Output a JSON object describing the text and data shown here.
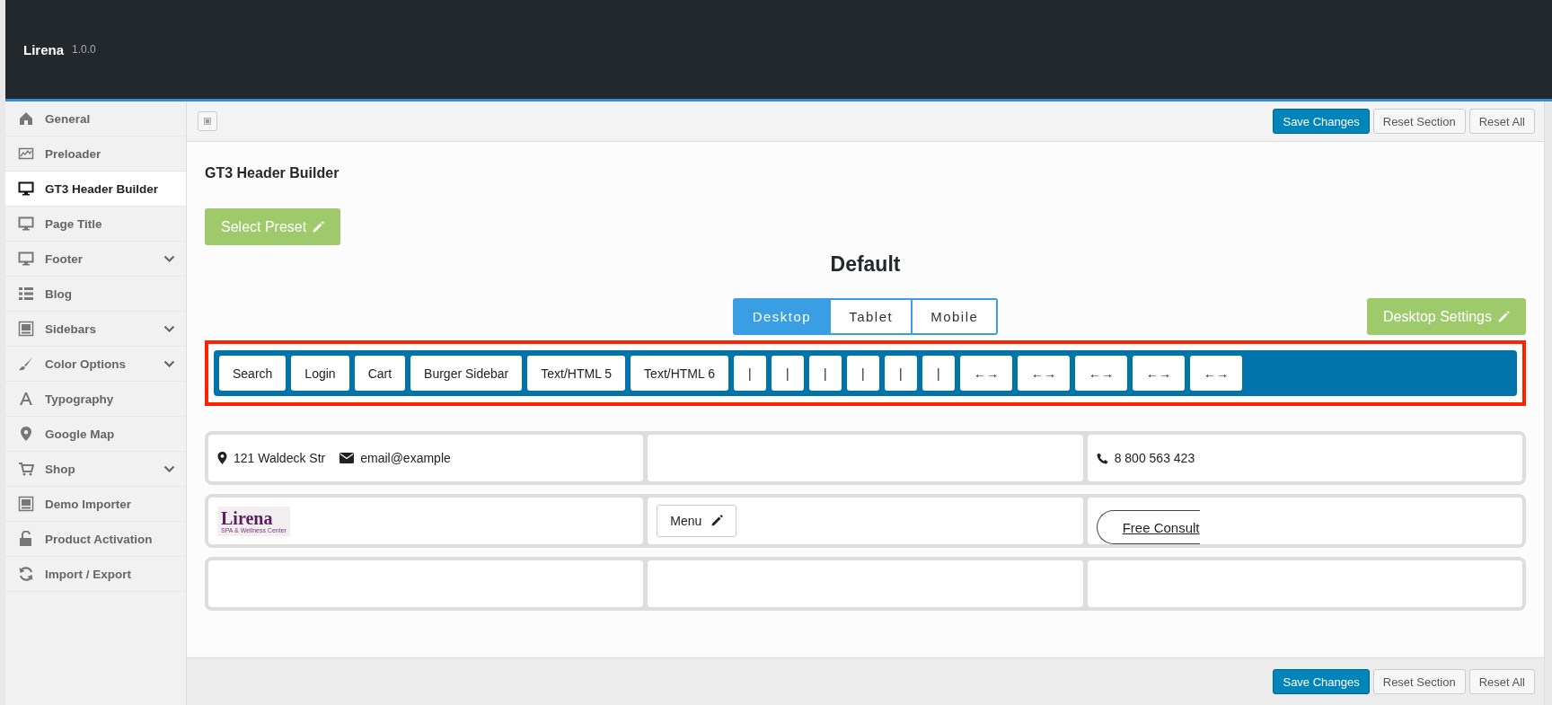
{
  "app": {
    "name": "Lirena",
    "version": "1.0.0"
  },
  "sidebar": {
    "items": [
      {
        "label": "General",
        "selected": false,
        "has_submenu": false
      },
      {
        "label": "Preloader",
        "selected": false,
        "has_submenu": false
      },
      {
        "label": "GT3 Header Builder",
        "selected": true,
        "has_submenu": false
      },
      {
        "label": "Page Title",
        "selected": false,
        "has_submenu": false
      },
      {
        "label": "Footer",
        "selected": false,
        "has_submenu": true
      },
      {
        "label": "Blog",
        "selected": false,
        "has_submenu": false
      },
      {
        "label": "Sidebars",
        "selected": false,
        "has_submenu": true
      },
      {
        "label": "Color Options",
        "selected": false,
        "has_submenu": true
      },
      {
        "label": "Typography",
        "selected": false,
        "has_submenu": false
      },
      {
        "label": "Google Map",
        "selected": false,
        "has_submenu": false
      },
      {
        "label": "Shop",
        "selected": false,
        "has_submenu": true
      },
      {
        "label": "Demo Importer",
        "selected": false,
        "has_submenu": false
      },
      {
        "label": "Product Activation",
        "selected": false,
        "has_submenu": false
      },
      {
        "label": "Import / Export",
        "selected": false,
        "has_submenu": false
      }
    ]
  },
  "toolbar": {
    "buttons": [
      {
        "label": "Save Changes",
        "kind": "primary"
      },
      {
        "label": "Reset Section",
        "kind": "secondary"
      },
      {
        "label": "Reset All",
        "kind": "secondary"
      }
    ]
  },
  "section_title": "GT3 Header Builder",
  "preset_button": "Select Preset",
  "preset_name": "Default",
  "device_tabs": [
    {
      "label": "Desktop",
      "selected": true
    },
    {
      "label": "Tablet",
      "selected": false
    },
    {
      "label": "Mobile",
      "selected": false
    }
  ],
  "settings_button": "Desktop Settings",
  "elements": [
    "Search",
    "Login",
    "Cart",
    "Burger Sidebar",
    "Text/HTML 5",
    "Text/HTML 6",
    "|",
    "|",
    "|",
    "|",
    "|",
    "|",
    "←→",
    "←→",
    "←→",
    "←→",
    "←→"
  ],
  "grid": {
    "rows": [
      {
        "cells": [
          [
            {
              "kind": "location",
              "text": "121 Waldeck Str"
            },
            {
              "kind": "email",
              "text": "email@example"
            }
          ],
          [],
          [
            {
              "kind": "phone",
              "text": "8 800 563 423"
            }
          ]
        ]
      },
      {
        "cells": [
          [
            {
              "kind": "logo",
              "text": "Lirena",
              "subtext": "SPA & Wellness Center"
            }
          ],
          [
            {
              "kind": "menu",
              "text": "Menu"
            }
          ],
          [
            {
              "kind": "button",
              "text": "Free Consult"
            }
          ]
        ]
      },
      {
        "cells": [
          [],
          [],
          []
        ]
      }
    ]
  },
  "footer": {
    "buttons": [
      {
        "label": "Save Changes",
        "kind": "primary"
      },
      {
        "label": "Reset Section",
        "kind": "secondary"
      },
      {
        "label": "Reset All",
        "kind": "secondary"
      }
    ]
  }
}
